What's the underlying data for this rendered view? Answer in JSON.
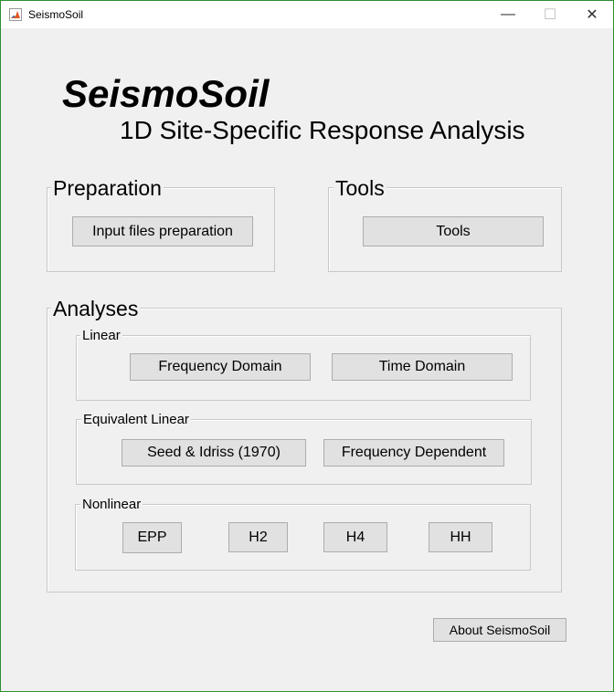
{
  "window": {
    "title": "SeismoSoil",
    "minimize_glyph": "—",
    "maximize_glyph": "☐",
    "close_glyph": "✕"
  },
  "header": {
    "app_name": "SeismoSoil",
    "subtitle": "1D Site-Specific Response Analysis"
  },
  "preparation": {
    "title": "Preparation",
    "input_button": "Input files preparation"
  },
  "tools": {
    "title": "Tools",
    "tools_button": "Tools"
  },
  "analyses": {
    "title": "Analyses",
    "linear": {
      "title": "Linear",
      "frequency_domain": "Frequency Domain",
      "time_domain": "Time Domain"
    },
    "equivalent_linear": {
      "title": "Equivalent Linear",
      "seed_idriss": "Seed & Idriss (1970)",
      "frequency_dependent": "Frequency Dependent"
    },
    "nonlinear": {
      "title": "Nonlinear",
      "epp": "EPP",
      "h2": "H2",
      "h4": "H4",
      "hh": "HH"
    }
  },
  "footer": {
    "about_button": "About SeismoSoil"
  },
  "icons": {
    "app": "matlab-icon"
  }
}
